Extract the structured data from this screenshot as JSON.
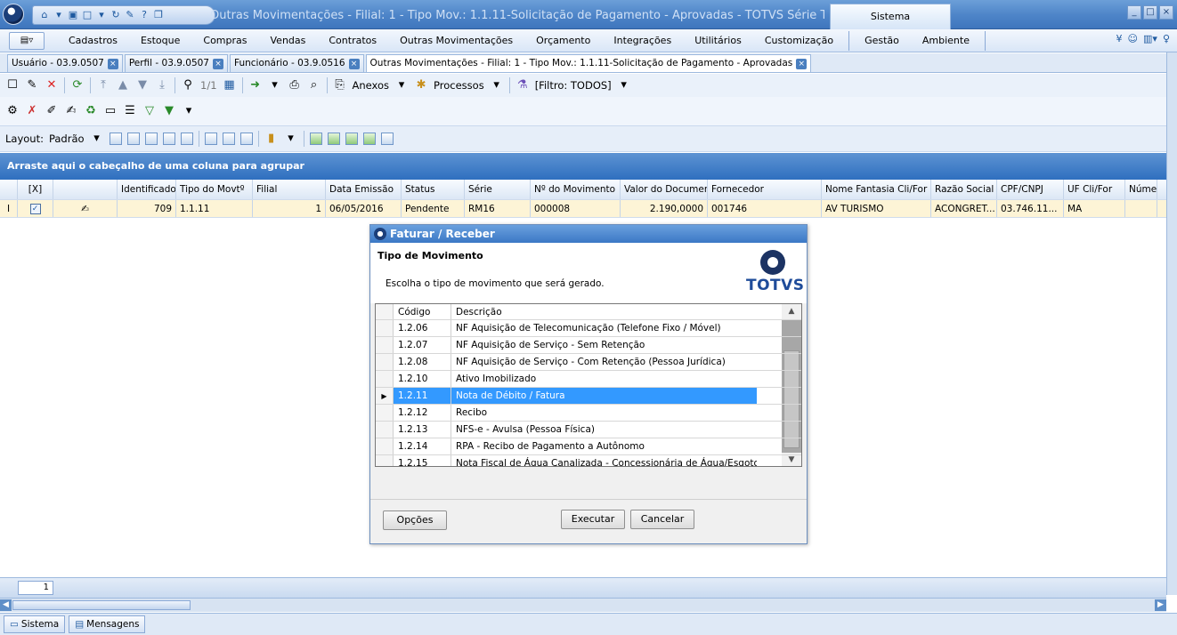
{
  "window": {
    "title": "Outras Movimentações - Filial: 1 - Tipo Mov.: 1.1.11-Solicitação de Pagamento - Aprovadas - TOTVS Série T Edu...",
    "context_tab": "Sistema"
  },
  "menu": {
    "items": [
      "Cadastros",
      "Estoque",
      "Compras",
      "Vendas",
      "Contratos",
      "Outras Movimentações",
      "Orçamento",
      "Integrações",
      "Utilitários",
      "Customização"
    ],
    "context_items": [
      "Gestão",
      "Ambiente"
    ]
  },
  "doc_tabs": [
    "Usuário - 03.9.0507",
    "Perfil - 03.9.0507",
    "Funcionário - 03.9.0516",
    "Outras Movimentações - Filial: 1 - Tipo Mov.: 1.1.11-Solicitação de Pagamento - Aprovadas"
  ],
  "toolbar1": {
    "page": "1/1",
    "anexos": "Anexos",
    "processos": "Processos",
    "filter": "[Filtro: TODOS]"
  },
  "toolbar3": {
    "layout_label": "Layout:",
    "layout_value": "Padrão"
  },
  "grid": {
    "group_hint": "Arraste aqui o cabeçalho de uma coluna para agrupar",
    "columns": [
      "[X]",
      "",
      "Identificador",
      "Tipo do Movtº",
      "Filial",
      "Data Emissão",
      "Status",
      "Série",
      "Nº do Movimento",
      "Valor do Documento",
      "Fornecedor",
      "Nome Fantasia Cli/For",
      "Razão Social",
      "CPF/CNPJ",
      "UF Cli/For",
      "Número"
    ],
    "row": {
      "identificador": "709",
      "tipo": "1.1.11",
      "filial": "1",
      "data": "06/05/2016",
      "status": "Pendente",
      "serie": "RM16",
      "numero": "000008",
      "valor": "2.190,0000",
      "fornecedor": "001746",
      "nome_fantasia": "AV TURISMO",
      "razao": "ACONGRET...",
      "cpf": "03.746.11...",
      "uf": "MA"
    },
    "page_number": "1"
  },
  "dialog": {
    "title": "Faturar / Receber",
    "heading": "Tipo de Movimento",
    "subheading": "Escolha o tipo de movimento que será gerado.",
    "logo_text": "TOTVS",
    "col_code": "Código",
    "col_desc": "Descrição",
    "rows": [
      {
        "code": "1.2.06",
        "desc": "NF Aquisição de Telecomunicação (Telefone Fixo / Móvel)"
      },
      {
        "code": "1.2.07",
        "desc": "NF Aquisição de Serviço - Sem Retenção"
      },
      {
        "code": "1.2.08",
        "desc": "NF Aquisição de Serviço - Com Retenção (Pessoa Jurídica)"
      },
      {
        "code": "1.2.10",
        "desc": "Ativo Imobilizado"
      },
      {
        "code": "1.2.11",
        "desc": "Nota de Débito / Fatura"
      },
      {
        "code": "1.2.12",
        "desc": "Recibo"
      },
      {
        "code": "1.2.13",
        "desc": "NFS-e - Avulsa (Pessoa Física)"
      },
      {
        "code": "1.2.14",
        "desc": "RPA - Recibo de Pagamento a Autônomo"
      },
      {
        "code": "1.2.15",
        "desc": "Nota Fiscal de Água Canalizada - Concessionária de Água/Esgoto"
      }
    ],
    "selected_code": "1.2.11",
    "btn_options": "Opções",
    "btn_execute": "Executar",
    "btn_cancel": "Cancelar"
  },
  "status": {
    "sistema": "Sistema",
    "mensagens": "Mensagens"
  }
}
